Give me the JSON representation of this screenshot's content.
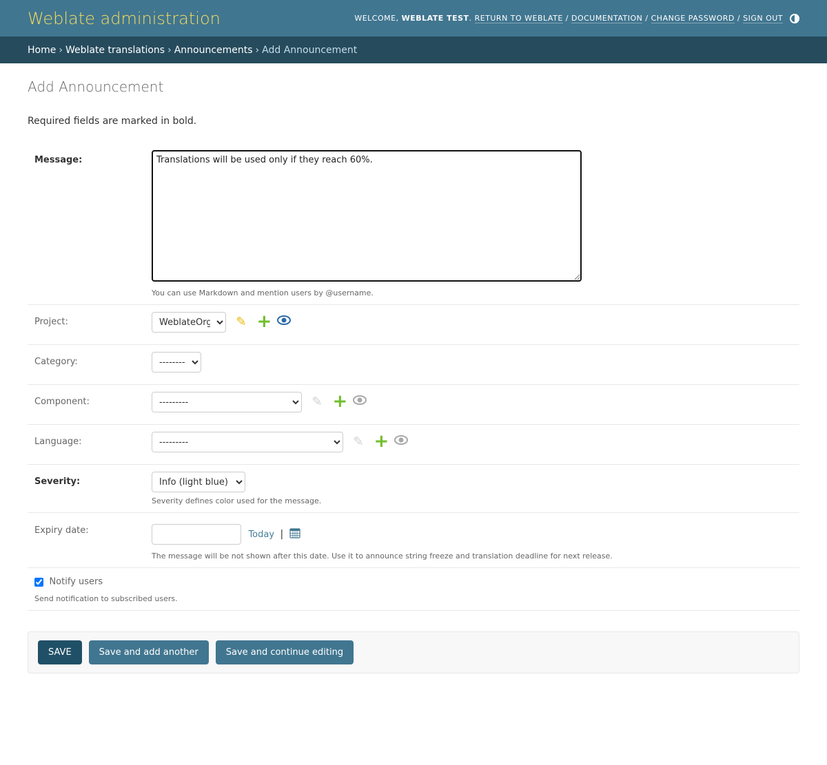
{
  "header": {
    "site_name": "Weblate administration",
    "welcome": "Welcome,",
    "user": "Weblate Test",
    "links": {
      "return": "Return to Weblate",
      "docs": "Documentation",
      "password": "Change password",
      "signout": "Sign out"
    }
  },
  "breadcrumbs": {
    "home": "Home",
    "app": "Weblate translations",
    "model": "Announcements",
    "current": "Add Announcement"
  },
  "page": {
    "title": "Add Announcement",
    "required_note": "Required fields are marked in bold."
  },
  "form": {
    "message": {
      "label": "Message:",
      "value": "Translations will be used only if they reach 60%.",
      "help": "You can use Markdown and mention users by @username."
    },
    "project": {
      "label": "Project:",
      "selected": "WeblateOrg"
    },
    "category": {
      "label": "Category:",
      "selected": "---------"
    },
    "component": {
      "label": "Component:",
      "selected": "---------"
    },
    "language": {
      "label": "Language:",
      "selected": "---------"
    },
    "severity": {
      "label": "Severity:",
      "selected": "Info (light blue)",
      "help": "Severity defines color used for the message."
    },
    "expiry": {
      "label": "Expiry date:",
      "value": "",
      "today": "Today",
      "separator": "|",
      "help": "The message will be not shown after this date. Use it to announce string freeze and translation deadline for next release."
    },
    "notify": {
      "label": "Notify users",
      "checked": true,
      "help": "Send notification to subscribed users."
    }
  },
  "buttons": {
    "save": "Save",
    "save_add": "Save and add another",
    "save_continue": "Save and continue editing"
  },
  "colors": {
    "header_bg": "#417690",
    "breadcrumb_bg": "#264b5d",
    "brand_yellow": "#f5dd5d",
    "add_green": "#70bf2b",
    "view_blue": "#417690"
  }
}
